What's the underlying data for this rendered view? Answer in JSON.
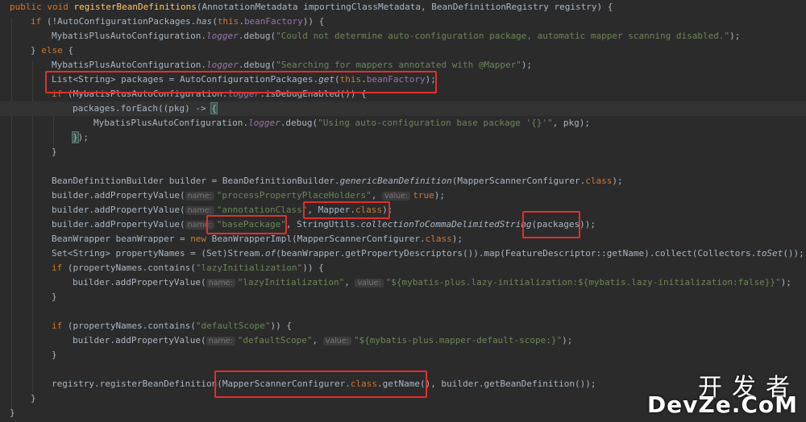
{
  "editor": {
    "theme_colors": {
      "background": "#2b2b2b",
      "keyword": "#cc7832",
      "function": "#ffc66d",
      "string": "#6a8759",
      "field": "#9876aa",
      "highlight_box": "#e0302e"
    },
    "code": {
      "l1": {
        "kw1": "public",
        "kw2": "void",
        "name": "registerBeanDefinitions",
        "rest": "(AnnotationMetadata importingClassMetadata, BeanDefinitionRegistry registry) {"
      },
      "l2": {
        "kw": "if",
        "pre": " (!AutoConfigurationPackages.",
        "call": "has",
        "mid": "(",
        "this": "this",
        "dot": ".",
        "field": "beanFactory",
        "end": ")) {"
      },
      "l3": {
        "cls": "MybatisPlusAutoConfiguration.",
        "field": "logger",
        "mid": ".debug(",
        "str": "\"Could not determine auto-configuration package, automatic mapper scanning disabled.\"",
        "end": ");"
      },
      "l4": {
        "pre": "} ",
        "kw": "else",
        "end": " {"
      },
      "l5": {
        "cls": "MybatisPlusAutoConfiguration.",
        "field": "logger",
        "mid": ".debug(",
        "str": "\"Searching for mappers annotated with @Mapper\"",
        "end": ");"
      },
      "l6": {
        "pre": "List<String> packages = AutoConfigurationPackages.",
        "call": "get",
        "mid": "(",
        "this": "this",
        "dot": ".",
        "field": "beanFactory",
        "end": ");"
      },
      "l7": {
        "kw": "if",
        "pre": " (MybatisPlusAutoConfiguration.",
        "field": "logger",
        "end": ".isDebugEnabled()) {"
      },
      "l8": {
        "pre": "packages.forEach((pkg) -> ",
        "brace": "{"
      },
      "l9": {
        "cls": "MybatisPlusAutoConfiguration.",
        "field": "logger",
        "mid": ".debug(",
        "str": "\"Using auto-configuration base package '{}'\"",
        "end": ", pkg);"
      },
      "l10": {
        "brace": "}",
        "end": ");"
      },
      "l11": {
        "text": "}"
      },
      "l12": {
        "pre": "BeanDefinitionBuilder builder = BeanDefinitionBuilder.",
        "call": "genericBeanDefinition",
        "mid": "(MapperScannerConfigurer.",
        "kw": "class",
        "end": ");"
      },
      "l13": {
        "pre": "builder.addPropertyValue(",
        "hint1": "name:",
        "str": "\"processPropertyPlaceHolders\"",
        "sep": ", ",
        "hint2": "value:",
        "kw": "true",
        "end": ");"
      },
      "l14": {
        "pre": "builder.addPropertyValue(",
        "hint1": "name:",
        "str": "\"annotationClass\"",
        "sep": ", ",
        "val": "Mapper.",
        "kw": "class",
        "end": ");"
      },
      "l15": {
        "pre": "builder.addPropertyValue(",
        "hint1": "name:",
        "str": "\"basePackage\"",
        "sep": ", StringUtils.",
        "call": "collectionToCommaDelimitedString",
        "end": "(packages));"
      },
      "l16": {
        "pre": "BeanWrapper beanWrapper = ",
        "kw": "new",
        "rest": " BeanWrapperImpl(MapperScannerConfigurer.",
        "kw2": "class",
        "end": ");"
      },
      "l17": {
        "pre": "Set<String> propertyNames = (Set)Stream.",
        "call": "of",
        "mid": "(beanWrapper.getPropertyDescriptors()).map(FeatureDescriptor::getName).collect(Collectors.",
        "call2": "toSet",
        "end": "());"
      },
      "l18": {
        "kw": "if",
        "pre": " (propertyNames.contains(",
        "str": "\"lazyInitialization\"",
        "end": ")) {"
      },
      "l19": {
        "pre": "builder.addPropertyValue(",
        "hint1": "name:",
        "str": "\"lazyInitialization\"",
        "sep": ", ",
        "hint2": "value:",
        "str2": "\"${mybatis-plus.lazy-initialization:${mybatis.lazy-initialization:false}}\"",
        "end": ");"
      },
      "l20": {
        "text": "}"
      },
      "l21": {
        "kw": "if",
        "pre": " (propertyNames.contains(",
        "str": "\"defaultScope\"",
        "end": ")) {"
      },
      "l22": {
        "pre": "builder.addPropertyValue(",
        "hint1": "name:",
        "str": "\"defaultScope\"",
        "sep": ", ",
        "hint2": "value:",
        "str2": "\"${mybatis-plus.mapper-default-scope:}\"",
        "end": ");"
      },
      "l23": {
        "text": "}"
      },
      "l24": {
        "pre": "registry.registerBeanDefinition(MapperScannerConfigurer.",
        "kw": "class",
        "mid": ".getName(), builder.getBeanDefinition());"
      },
      "l25": {
        "text": "}"
      },
      "l26": {
        "text": "}"
      }
    }
  },
  "watermark": {
    "cn": "开发者",
    "en": "DevZe.CoM"
  }
}
